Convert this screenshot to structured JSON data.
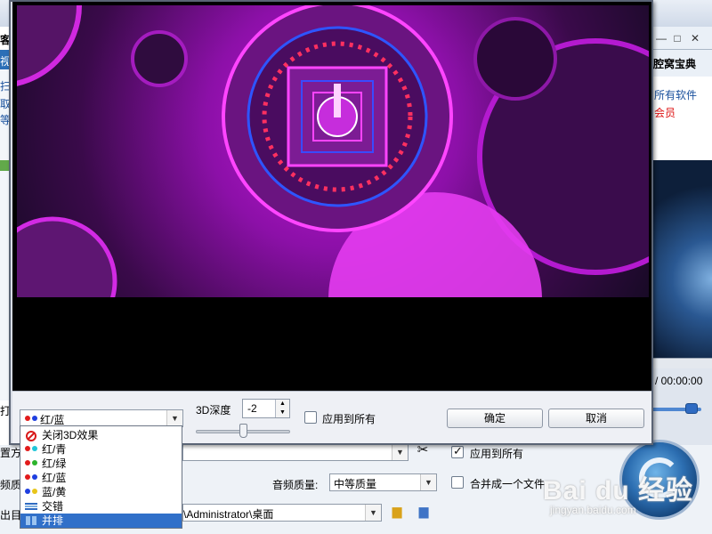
{
  "background_window": {
    "title_char": "客",
    "window_buttons": [
      "—",
      "□",
      "✕"
    ],
    "left_labels": [
      "视",
      "扫",
      "取",
      "等"
    ],
    "right_title": "腔窝宝典",
    "right_link_1": "所有软件",
    "right_link_2": "会员",
    "time_text": "/ 00:00:00",
    "left_partial_1": "打",
    "left_partial_2": "置方",
    "left_partial_3": "频质",
    "left_partial_4": "出目",
    "apply_all_label": "应用到所有",
    "audio_quality_label": "音频质量:",
    "audio_quality_value": "中等质量",
    "merge_label": "合并成一个文件",
    "output_path": "\\Administrator\\桌面"
  },
  "dialog": {
    "mode_select_value": "红/蓝",
    "depth_label": "3D深度",
    "depth_value": "-2",
    "depth_level": 0.5,
    "apply_all_label": "应用到所有",
    "ok_label": "确定",
    "cancel_label": "取消"
  },
  "mode_options": [
    {
      "label": "关闭3D效果",
      "icon": "no-entry-icon"
    },
    {
      "label": "红/青",
      "icon": "red-cyan-glasses-icon"
    },
    {
      "label": "红/绿",
      "icon": "red-green-glasses-icon"
    },
    {
      "label": "红/蓝",
      "icon": "red-blue-glasses-icon"
    },
    {
      "label": "蓝/黄",
      "icon": "blue-yellow-glasses-icon"
    },
    {
      "label": "交错",
      "icon": "interlaced-icon"
    },
    {
      "label": "并排",
      "icon": "side-by-side-icon"
    }
  ],
  "selected_option": "并排",
  "watermark": {
    "main": "Bai du 经验",
    "sub": "jingyan.baidu.com"
  },
  "colors": {
    "selection": "#3170c9",
    "video_magenta": "#c318d8",
    "accent_blue": "#2f6bc2"
  }
}
